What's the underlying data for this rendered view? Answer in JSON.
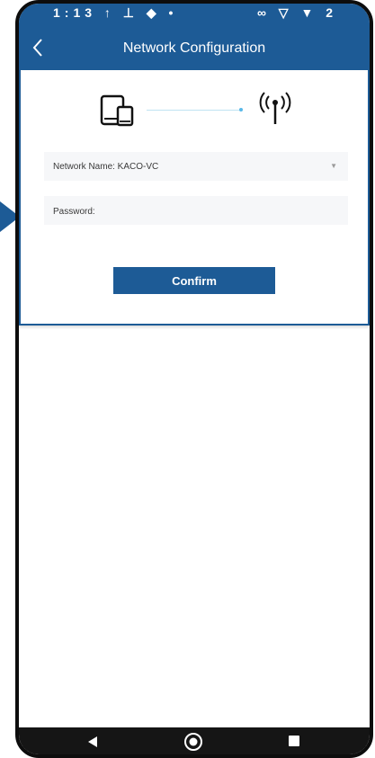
{
  "status_bar": {
    "left_text": "1:13 ↑ ⊥ ◆ •",
    "right_text": "∞ ▽ ▼ 2"
  },
  "header": {
    "title": "Network Configuration",
    "back_icon": "chevron-left-icon"
  },
  "illustration": {
    "device_icon": "phone-tablet-icon",
    "target_icon": "wifi-antenna-icon",
    "link_color": "#58b8e8"
  },
  "form": {
    "network_label": "Network Name: KACO-VC",
    "dropdown_icon": "caret-down-icon",
    "password_placeholder": "Password:",
    "password_value": ""
  },
  "actions": {
    "confirm_label": "Confirm"
  },
  "colors": {
    "primary": "#1d5b96",
    "field_background": "#f6f7f9",
    "nav_bar": "#151515"
  },
  "system_nav": {
    "back_icon": "triangle-back-icon",
    "home_icon": "circle-home-icon",
    "recent_icon": "square-recent-icon"
  }
}
